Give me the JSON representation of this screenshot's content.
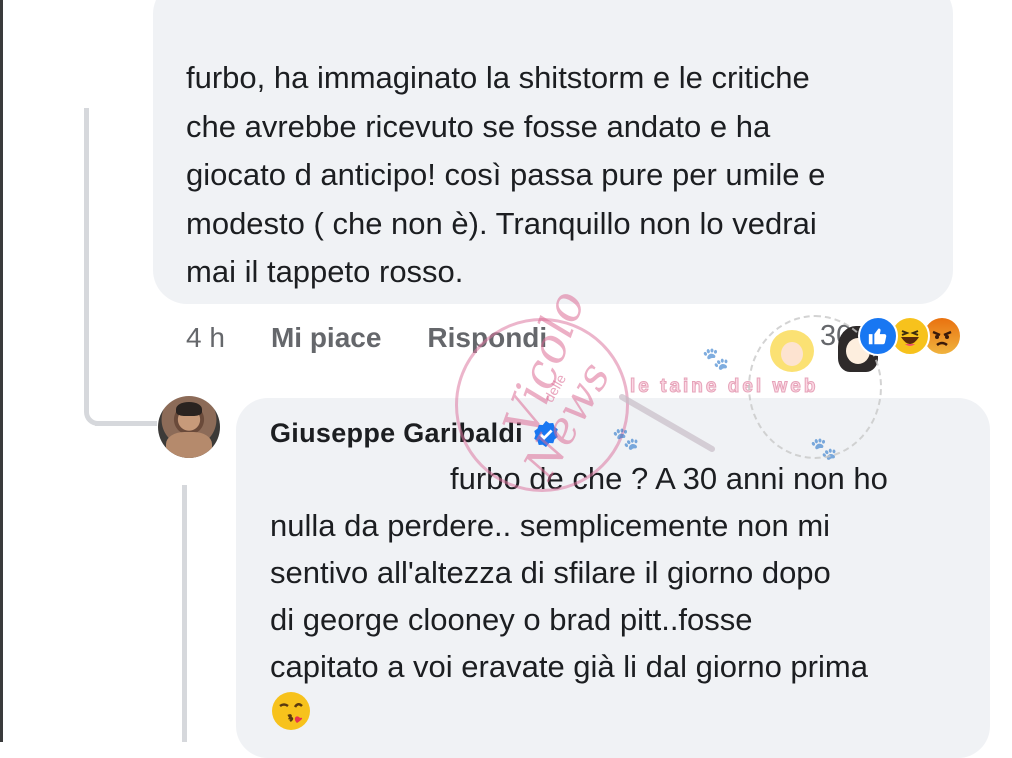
{
  "comment": {
    "text": "furbo, ha immaginato la shitstorm e le critiche\nche avrebbe ricevuto se fosse andato e ha\ngiocato d anticipo! così passa pure per umile e\nmodesto ( che non è). Tranquillo non lo vedrai\nmai il tappeto rosso.",
    "time": "4 h",
    "like_label": "Mi piace",
    "reply_label": "Rispondi",
    "reaction_count": "30",
    "reactions": [
      "like-icon",
      "haha-icon",
      "angry-icon"
    ]
  },
  "reply": {
    "author": "Giuseppe Garibaldi",
    "verified": true,
    "line1": "furbo de che ? A 30 anni non ho",
    "rest": "nulla da perdere.. semplicemente non mi\nsentivo all'altezza di sfilare il giorno dopo\ndi george clooney o brad pitt..fosse\ncapitato a voi eravate già li dal giorno prima",
    "emoji": "kissing-wink-icon"
  },
  "watermark": {
    "title_top": "Vicolo",
    "title_mid": "delle",
    "title_bottom": "News",
    "tagline": "le taine del web"
  },
  "colors": {
    "bubble": "#f0f2f5",
    "secondary_text": "#65676b",
    "like_blue": "#1877f2",
    "verified_blue": "#1877f2"
  }
}
